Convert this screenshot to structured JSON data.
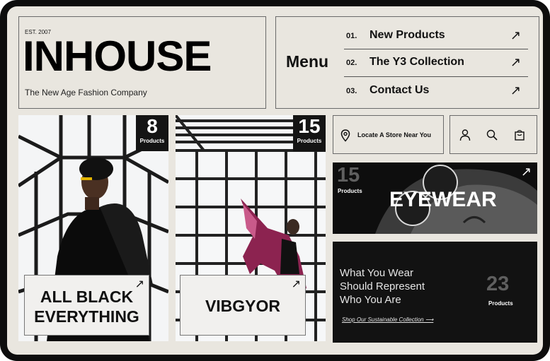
{
  "brand": {
    "est": "EST. 2007",
    "name": "INHOUSE",
    "tagline": "The New Age Fashion Company"
  },
  "menu": {
    "label": "Menu",
    "items": [
      {
        "num": "01.",
        "label": "New Products"
      },
      {
        "num": "02.",
        "label": "The Y3 Collection"
      },
      {
        "num": "03.",
        "label": "Contact Us"
      }
    ],
    "arrow": "↗"
  },
  "cards": [
    {
      "count": "8",
      "count_label": "Products",
      "line1": "ALL BLACK",
      "line2": "EVERYTHING"
    },
    {
      "count": "15",
      "count_label": "Products",
      "title": "VIBGYOR"
    }
  ],
  "store": {
    "label": "Locate A Store Near You",
    "icon": "map-pin-icon"
  },
  "header_icons": [
    "user-icon",
    "search-icon",
    "shopping-bag-icon"
  ],
  "eyewear": {
    "count": "15",
    "count_label": "Products",
    "title": "EYEWEAR"
  },
  "sustainable": {
    "line1": "What You Wear",
    "line2": "Should Represent",
    "line3": "Who You Are",
    "link": "Shop Our Sustainable Collection ⟶",
    "count": "23",
    "count_label": "Products"
  },
  "colors": {
    "background": "#e9e6df",
    "frame": "#0d0d0d",
    "dark_panel": "#121212",
    "text": "#111111"
  }
}
